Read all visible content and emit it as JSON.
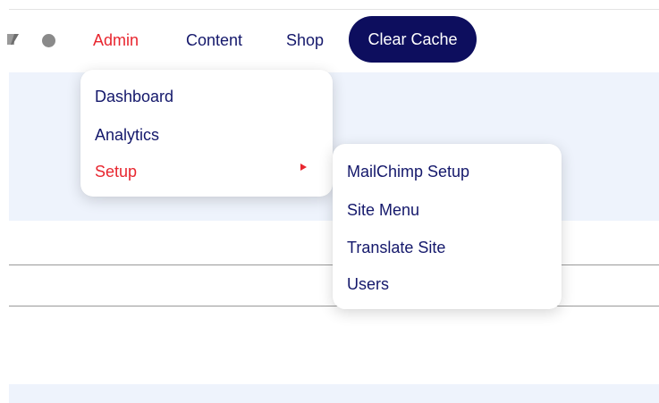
{
  "navbar": {
    "logo_icon": "app-logo-icon",
    "status_dot_color": "#8a8a8a",
    "items": [
      {
        "label": "Admin",
        "active": true
      },
      {
        "label": "Content",
        "active": false
      },
      {
        "label": "Shop",
        "active": false
      }
    ],
    "clear_cache_label": "Clear Cache"
  },
  "admin_menu": {
    "items": [
      {
        "label": "Dashboard",
        "active": false
      },
      {
        "label": "Analytics",
        "active": false
      },
      {
        "label": "Setup",
        "active": true,
        "has_submenu": true
      }
    ]
  },
  "setup_submenu": {
    "items": [
      {
        "label": "MailChimp Setup"
      },
      {
        "label": "Site Menu"
      },
      {
        "label": "Translate Site"
      },
      {
        "label": "Users"
      }
    ]
  },
  "colors": {
    "accent": "#e8262f",
    "nav_text": "#14186b",
    "button_bg": "#0d0e5e",
    "band_bg": "#eef3fc"
  }
}
